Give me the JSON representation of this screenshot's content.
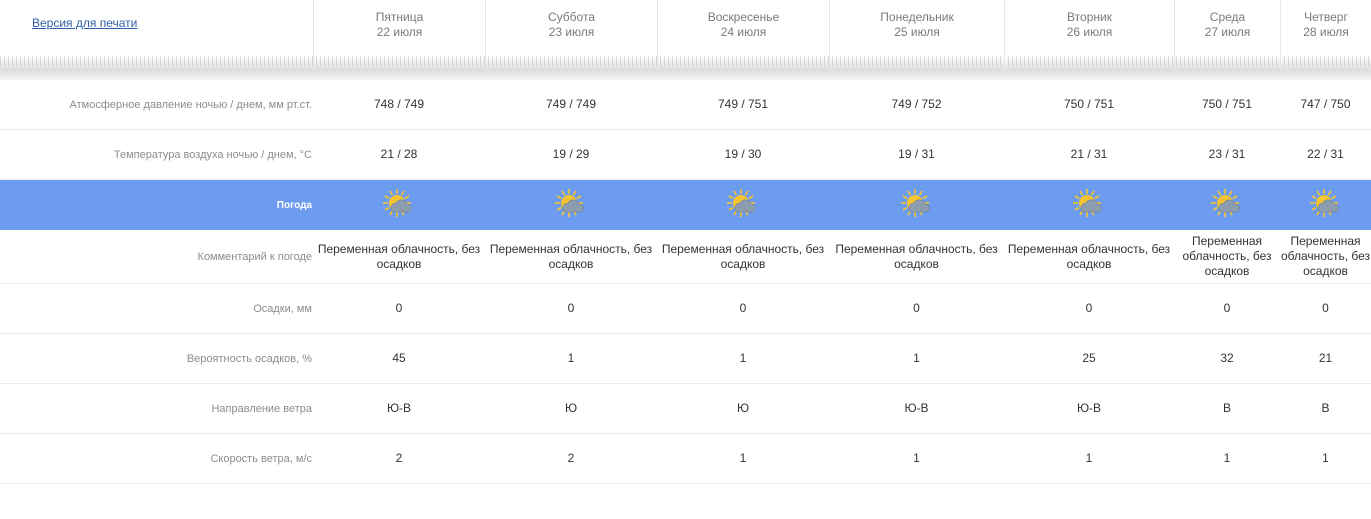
{
  "print_link": "Версия для печати",
  "days": [
    {
      "name": "Пятница",
      "date": "22 июля"
    },
    {
      "name": "Суббота",
      "date": "23 июля"
    },
    {
      "name": "Воскресенье",
      "date": "24 июля"
    },
    {
      "name": "Понедельник",
      "date": "25 июля"
    },
    {
      "name": "Вторник",
      "date": "26 июля"
    },
    {
      "name": "Среда",
      "date": "27 июля"
    },
    {
      "name": "Четверг",
      "date": "28 июля"
    }
  ],
  "rows": {
    "pressure": {
      "label": "Атмосферное давление ночью / днем, мм рт.ст.",
      "values": [
        "748 / 749",
        "749 / 749",
        "749 / 751",
        "749 / 752",
        "750 / 751",
        "750 / 751",
        "747 / 750"
      ]
    },
    "temperature": {
      "label": "Температура воздуха ночью / днем, °C",
      "values": [
        "21 / 28",
        "19 / 29",
        "19 / 30",
        "19 / 31",
        "21 / 31",
        "23 / 31",
        "22 / 31"
      ]
    },
    "weather": {
      "label": "Погода",
      "icons": [
        "partly-cloudy-icon",
        "partly-cloudy-icon",
        "partly-cloudy-icon",
        "partly-cloudy-icon",
        "partly-cloudy-icon",
        "partly-cloudy-icon",
        "partly-cloudy-icon"
      ]
    },
    "comment": {
      "label": "Комментарий к погоде",
      "values": [
        "Переменная облачность, без осадков",
        "Переменная облачность, без осадков",
        "Переменная облачность, без осадков",
        "Переменная облачность, без осадков",
        "Переменная облачность, без осадков",
        "Переменная облачность, без осадков",
        "Переменная облачность, без осадков"
      ]
    },
    "precipitation": {
      "label": "Осадки, мм",
      "values": [
        "0",
        "0",
        "0",
        "0",
        "0",
        "0",
        "0"
      ]
    },
    "probability": {
      "label": "Вероятность осадков, %",
      "values": [
        "45",
        "1",
        "1",
        "1",
        "25",
        "32",
        "21"
      ]
    },
    "wind_dir": {
      "label": "Направление ветра",
      "values": [
        "Ю-В",
        "Ю",
        "Ю",
        "Ю-В",
        "Ю-В",
        "В",
        "В"
      ]
    },
    "wind_speed": {
      "label": "Скорость ветра, м/с",
      "values": [
        "2",
        "2",
        "1",
        "1",
        "1",
        "1",
        "1"
      ]
    }
  },
  "colors": {
    "weather_band": "#6d9bef",
    "link": "#2f5fa8",
    "sun": "#f4c430",
    "cloud": "#8d9db0"
  }
}
